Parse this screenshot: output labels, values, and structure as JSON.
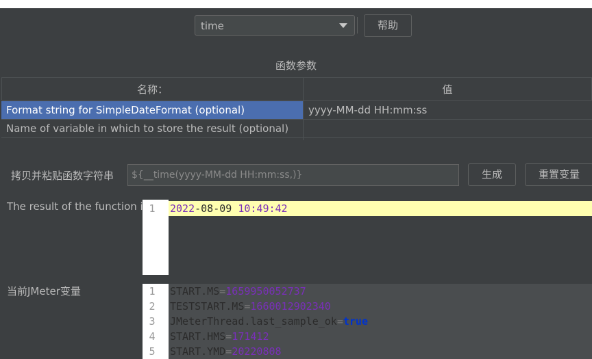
{
  "function_select": {
    "value": "time"
  },
  "help_button": "帮助",
  "section_title": "函数参数",
  "params_table": {
    "columns": [
      "名称：",
      "值"
    ],
    "rows": [
      {
        "name": "Format string for SimpleDateFormat (optional)",
        "value": "yyyy-MM-dd HH:mm:ss"
      },
      {
        "name": "Name of variable in which to store the result (optional)",
        "value": ""
      }
    ]
  },
  "copy_paste_label": "拷贝并粘贴函数字符串",
  "function_string": "${__time(yyyy-MM-dd HH:mm:ss,)}",
  "generate_button": "生成",
  "reset_button": "重置变量",
  "result_label": "The result of the function is",
  "result_lines": [
    {
      "num": "1",
      "date": "2022",
      "d1": "-",
      "m": "08",
      "d2": "-",
      "d": "09",
      "sp": " ",
      "time": "10:49:42"
    }
  ],
  "vars_label": "当前JMeter变量",
  "vars_lines": [
    {
      "num": "1",
      "key": "START.MS",
      "eq": "=",
      "val": "1659950052737"
    },
    {
      "num": "2",
      "key": "TESTSTART.MS",
      "eq": "=",
      "val": "1660012902340"
    },
    {
      "num": "3",
      "key": "JMeterThread.last_sample_ok",
      "eq": "=",
      "val": "true"
    },
    {
      "num": "4",
      "key": "START.HMS",
      "eq": "=",
      "val": "171412"
    },
    {
      "num": "5",
      "key": "START.YMD",
      "eq": "=",
      "val": "20220808"
    }
  ],
  "colors": {
    "background": "#3c3f41",
    "selection": "#4b6eaf",
    "highlight": "#ffffb0",
    "number": "#7a2fba",
    "boolean": "#0033cc"
  }
}
